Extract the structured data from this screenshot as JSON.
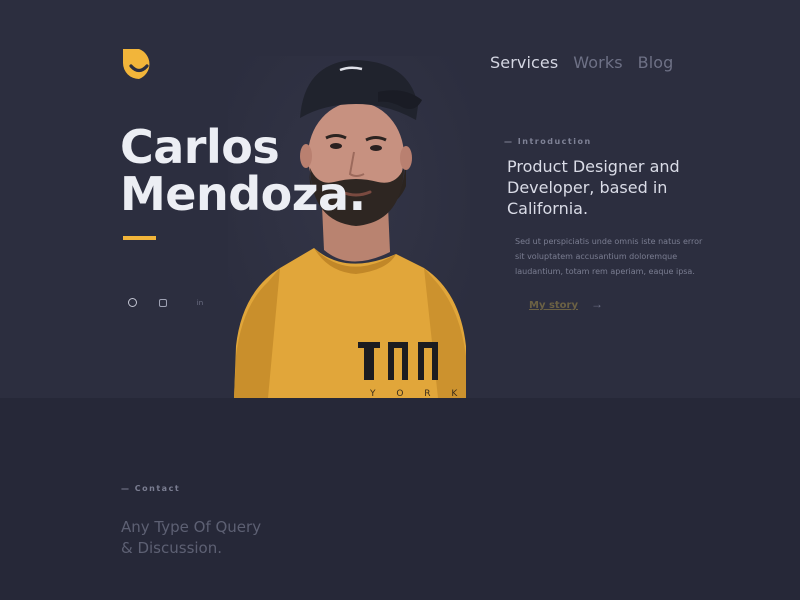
{
  "colors": {
    "background": "#2c2e3f",
    "lower_background": "#262838",
    "accent": "#f2b53a",
    "heading": "#eceef4",
    "muted": "#6e7186"
  },
  "brand": {
    "logo": "yellow-d-smile-logo"
  },
  "nav": {
    "items": [
      {
        "label": "Services",
        "state": "active"
      },
      {
        "label": "Works",
        "state": "inactive"
      },
      {
        "label": "Blog",
        "state": "inactive"
      }
    ]
  },
  "hero": {
    "name_line1": "Carlos",
    "name_line2": "Mendoza.",
    "social": [
      {
        "icon": "dribbble-icon"
      },
      {
        "icon": "instagram-icon"
      },
      {
        "icon": "linkedin-icon",
        "glyph": "in"
      }
    ],
    "photo": {
      "shirt_text_line1": "ɈΠΠ",
      "shirt_text_line2": "Y O R K"
    }
  },
  "intro": {
    "label": "— Introduction",
    "title": "Product Designer and Developer, based in California.",
    "text": "Sed ut perspiciatis unde omnis iste natus error sit voluptatem accusantium doloremque laudantium, totam rem aperiam, eaque ipsa.",
    "link_label": "My story",
    "link_arrow": "→"
  },
  "contact": {
    "label": "— Contact",
    "title_line1": "Any Type Of Query",
    "title_line2": "& Discussion."
  }
}
